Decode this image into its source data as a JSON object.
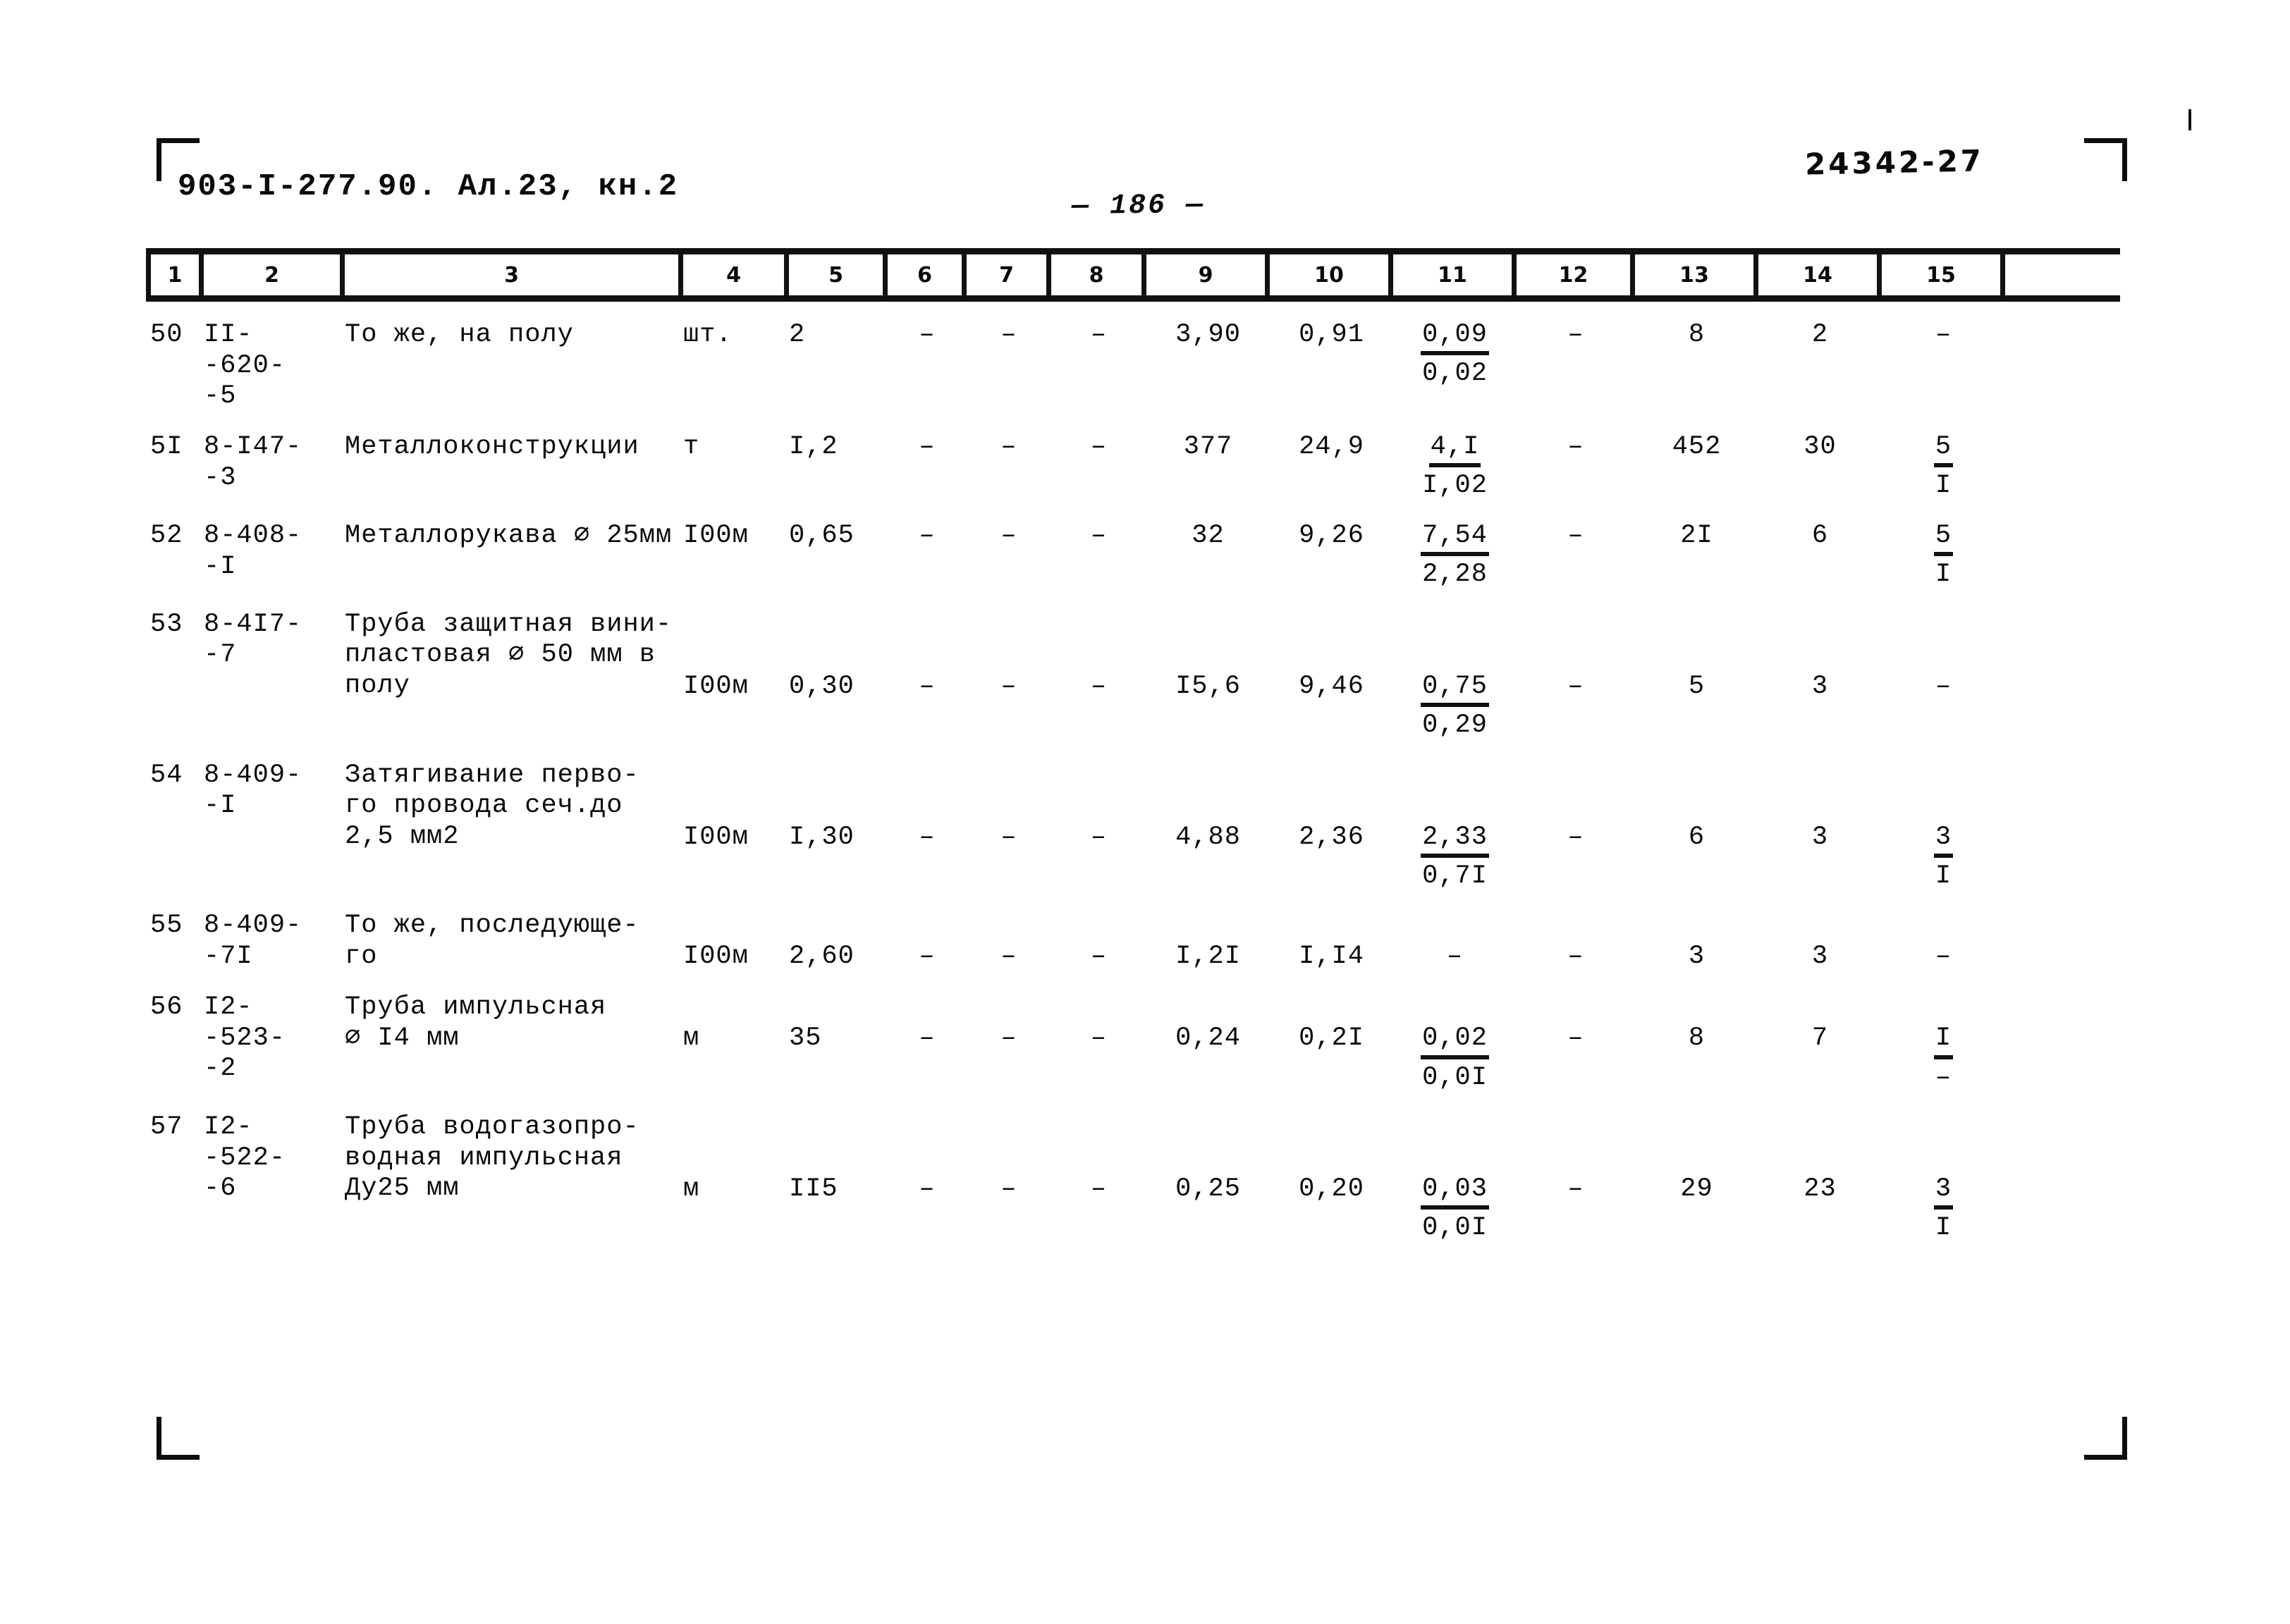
{
  "header": {
    "doc_code": "903-I-277.90. Ал.23, кн.2",
    "sheet_number": "— 186 —",
    "archive_code": "24342-27"
  },
  "table": {
    "column_headers": [
      "1",
      "2",
      "3",
      "4",
      "5",
      "6",
      "7",
      "8",
      "9",
      "10",
      "11",
      "12",
      "13",
      "14",
      "15"
    ],
    "dash": "–",
    "rows": [
      {
        "num": "50",
        "code": "II-\n-620-\n-5",
        "desc": "То же, на полу",
        "unit": "шт.",
        "qty": "2",
        "c6": "–",
        "c7": "–",
        "c8": "–",
        "c9": "3,90",
        "c10": "0,91",
        "c11_top": "0,09",
        "c11_bot": "0,02",
        "c12": "–",
        "c13": "8",
        "c14": "2",
        "c15_top": "–",
        "c15_bot": ""
      },
      {
        "num": "5I",
        "code": "8-I47-\n-3",
        "desc": "Металлоконструкции",
        "unit": "т",
        "qty": "I,2",
        "c6": "–",
        "c7": "–",
        "c8": "–",
        "c9": "377",
        "c10": "24,9",
        "c11_top": "4,I",
        "c11_bot": "I,02",
        "c12": "–",
        "c13": "452",
        "c14": "30",
        "c15_top": "5",
        "c15_bot": "I"
      },
      {
        "num": "52",
        "code": "8-408-\n-I",
        "desc": "Металлорукава ⌀ 25мм",
        "unit": "I00м",
        "qty": "0,65",
        "c6": "–",
        "c7": "–",
        "c8": "–",
        "c9": "32",
        "c10": "9,26",
        "c11_top": "7,54",
        "c11_bot": "2,28",
        "c12": "–",
        "c13": "2I",
        "c14": "6",
        "c15_top": "5",
        "c15_bot": "I"
      },
      {
        "num": "53",
        "code": "8-4I7-\n-7",
        "desc": "Труба защитная вини-\nпластовая ⌀ 50 мм в\nполу",
        "unit": "I00м",
        "qty": "0,30",
        "c6": "–",
        "c7": "–",
        "c8": "–",
        "c9": "I5,6",
        "c10": "9,46",
        "c11_top": "0,75",
        "c11_bot": "0,29",
        "c12": "–",
        "c13": "5",
        "c14": "3",
        "c15_top": "–",
        "c15_bot": ""
      },
      {
        "num": "54",
        "code": "8-409-\n-I",
        "desc": "Затягивание перво-\nго провода сеч.до\n2,5 мм2",
        "unit": "I00м",
        "qty": "I,30",
        "c6": "–",
        "c7": "–",
        "c8": "–",
        "c9": "4,88",
        "c10": "2,36",
        "c11_top": "2,33",
        "c11_bot": "0,7I",
        "c12": "–",
        "c13": "6",
        "c14": "3",
        "c15_top": "3",
        "c15_bot": "I"
      },
      {
        "num": "55",
        "code": "8-409-\n-7I",
        "desc": "То же, последующе-\nго",
        "unit": "I00м",
        "qty": "2,60",
        "c6": "–",
        "c7": "–",
        "c8": "–",
        "c9": "I,2I",
        "c10": "I,I4",
        "c11_top": "–",
        "c11_bot": "",
        "c12": "–",
        "c13": "3",
        "c14": "3",
        "c15_top": "–",
        "c15_bot": ""
      },
      {
        "num": "56",
        "code": "I2-\n-523-\n-2",
        "desc": "Труба импульсная\n⌀ I4 мм",
        "unit": "м",
        "qty": "35",
        "c6": "–",
        "c7": "–",
        "c8": "–",
        "c9": "0,24",
        "c10": "0,2I",
        "c11_top": "0,02",
        "c11_bot": "0,0I",
        "c12": "–",
        "c13": "8",
        "c14": "7",
        "c15_top": "I",
        "c15_bot": "–"
      },
      {
        "num": "57",
        "code": "I2-\n-522-\n-6",
        "desc": "Труба водогазопро-\nводная импульсная\nДу25 мм",
        "unit": "м",
        "qty": "II5",
        "c6": "–",
        "c7": "–",
        "c8": "–",
        "c9": "0,25",
        "c10": "0,20",
        "c11_top": "0,03",
        "c11_bot": "0,0I",
        "c12": "–",
        "c13": "29",
        "c14": "23",
        "c15_top": "3",
        "c15_bot": "I"
      }
    ]
  }
}
